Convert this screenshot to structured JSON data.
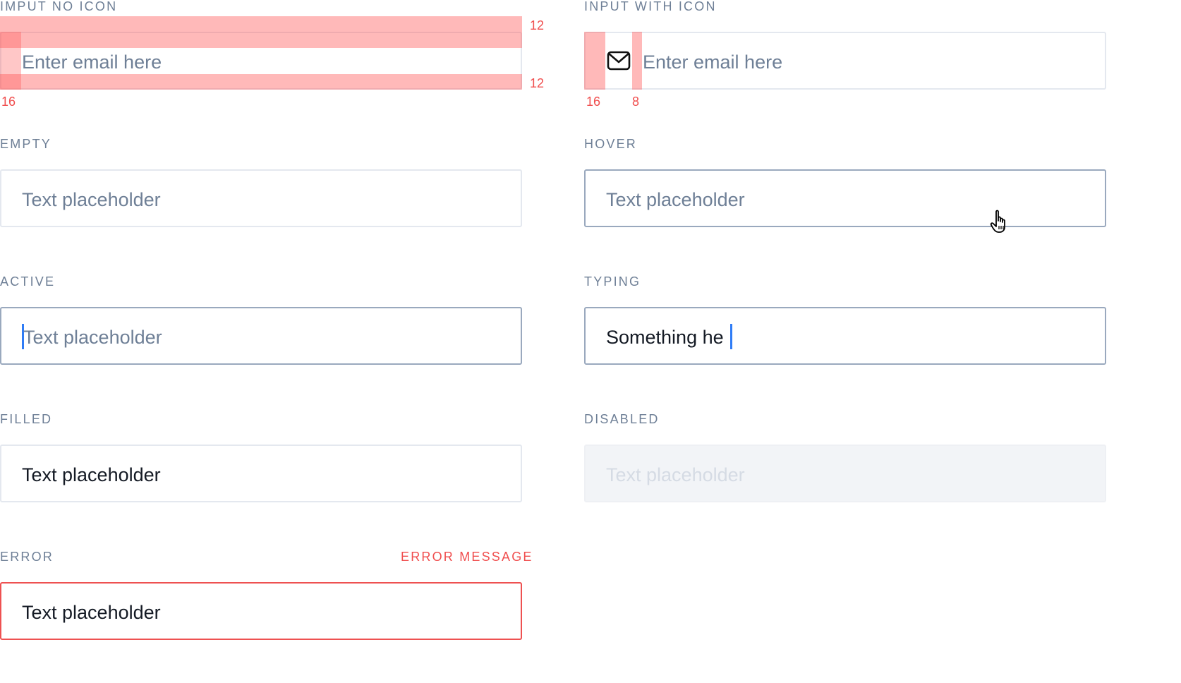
{
  "no_icon": {
    "label": "IMPUT NO ICON",
    "placeholder": "Enter email here",
    "spec_top": "12",
    "spec_bottom": "12",
    "spec_left": "16"
  },
  "with_icon": {
    "label": "INPUT WITH ICON",
    "placeholder": "Enter email here",
    "icon": "mail-icon",
    "spec_left": "16",
    "spec_gap": "8"
  },
  "states": {
    "empty": {
      "label": "EMPTY",
      "text": "Text placeholder"
    },
    "hover": {
      "label": "HOVER",
      "text": "Text placeholder"
    },
    "active": {
      "label": "ACTIVE",
      "text": "Text placeholder"
    },
    "typing": {
      "label": "TYPING",
      "text": "Something he"
    },
    "filled": {
      "label": "FILLED",
      "text": "Text placeholder"
    },
    "disabled": {
      "label": "DISABLED",
      "text": "Text placeholder"
    },
    "error": {
      "label": "ERROR",
      "text": "Text placeholder",
      "message": "ERROR MESSAGE"
    }
  },
  "colors": {
    "label": "#6e7f96",
    "placeholder": "#6e7f96",
    "text": "#141a24",
    "border_default": "#e4e8ef",
    "border_focus": "#9aa9be",
    "error": "#ee5151",
    "cursor": "#2f7cf6",
    "spec_overlay": "#ff5050"
  }
}
